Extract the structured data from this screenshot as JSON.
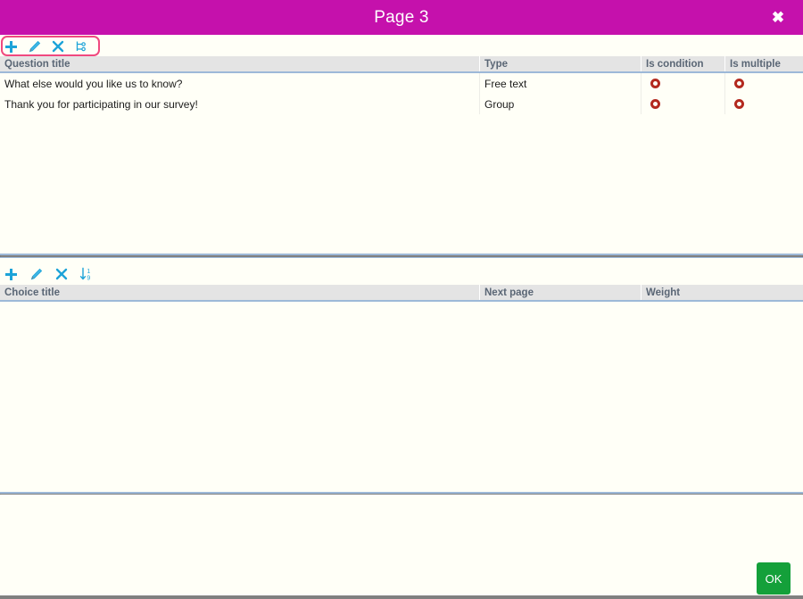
{
  "window": {
    "title": "Page 3",
    "close_label": "✖",
    "accent_color": "#C511AC",
    "body_background": "#FFFFF7",
    "header_background": "#E4E4E4",
    "grid_border_color": "#9DB9D8",
    "indicator_color": "#B3291F",
    "annotation_color": "#F0497F"
  },
  "questions_panel": {
    "toolbar": [
      {
        "name": "add",
        "glyph": "plus-icon",
        "label": "Add"
      },
      {
        "name": "edit",
        "glyph": "pencil-icon",
        "label": "Edit"
      },
      {
        "name": "delete",
        "glyph": "close-x-icon",
        "label": "Delete"
      },
      {
        "name": "hierarchy",
        "glyph": "tree-hierarchy-icon",
        "label": "Hierarchy"
      }
    ],
    "columns": [
      "Question title",
      "Type",
      "Is condition",
      "Is multiple"
    ],
    "rows": [
      {
        "question_title": "What else would you like us to know?",
        "type": "Free text",
        "is_condition": "false",
        "is_multiple": "false"
      },
      {
        "question_title": "Thank you for participating in our survey!",
        "type": "Group",
        "is_condition": "false",
        "is_multiple": "false"
      }
    ]
  },
  "choices_panel": {
    "toolbar": [
      {
        "name": "add",
        "glyph": "plus-icon",
        "label": "Add"
      },
      {
        "name": "edit",
        "glyph": "pencil-icon",
        "label": "Edit"
      },
      {
        "name": "delete",
        "glyph": "close-x-icon",
        "label": "Delete"
      },
      {
        "name": "sort",
        "glyph": "sort-ascending-icon",
        "label": "Sort"
      }
    ],
    "columns": [
      "Choice title",
      "Next page",
      "Weight"
    ],
    "rows": []
  },
  "footer": {
    "ok_label": "OK"
  }
}
